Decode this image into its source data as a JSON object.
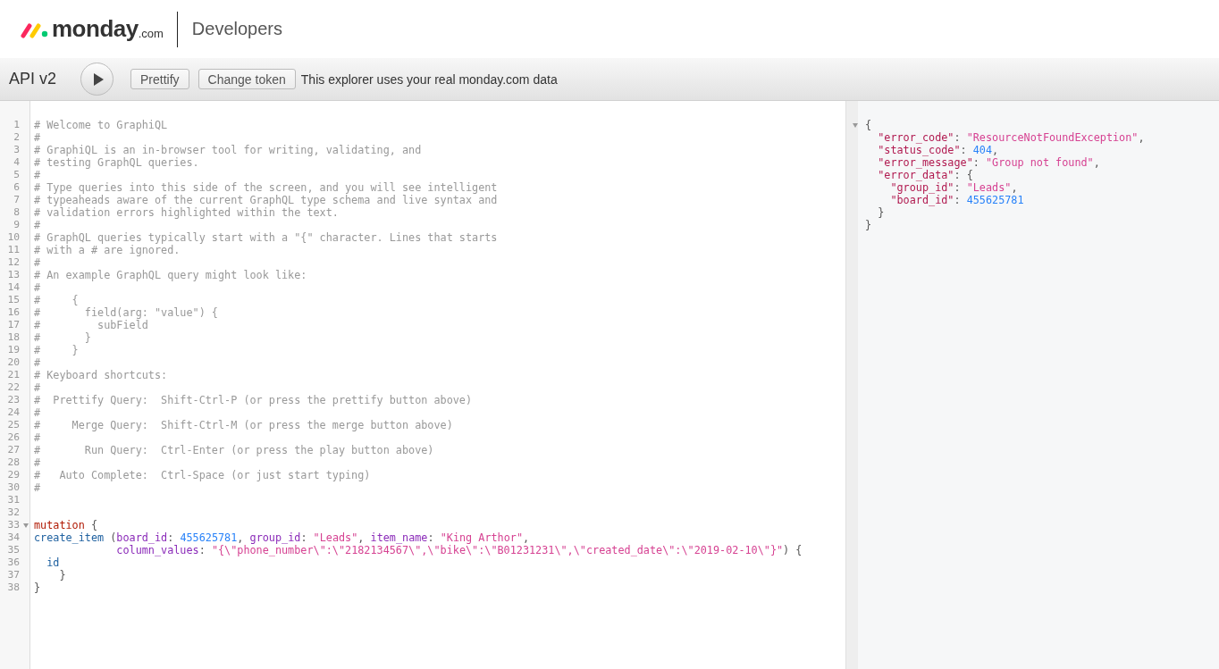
{
  "header": {
    "brand": "monday",
    "brand_suffix": ".com",
    "section": "Developers"
  },
  "toolbar": {
    "title": "API v2",
    "buttons": [
      "Prettify",
      "Change token"
    ],
    "notice": "This explorer uses your real monday.com data"
  },
  "editor": {
    "lines": [
      {
        "number": "1",
        "tokens": [
          {
            "text": "# Welcome to GraphiQL",
            "kind": "comment"
          }
        ]
      },
      {
        "number": "2",
        "tokens": [
          {
            "text": "#",
            "kind": "comment"
          }
        ]
      },
      {
        "number": "3",
        "tokens": [
          {
            "text": "# GraphiQL is an in-browser tool for writing, validating, and",
            "kind": "comment"
          }
        ]
      },
      {
        "number": "4",
        "tokens": [
          {
            "text": "# testing GraphQL queries.",
            "kind": "comment"
          }
        ]
      },
      {
        "number": "5",
        "tokens": [
          {
            "text": "#",
            "kind": "comment"
          }
        ]
      },
      {
        "number": "6",
        "tokens": [
          {
            "text": "# Type queries into this side of the screen, and you will see intelligent",
            "kind": "comment"
          }
        ]
      },
      {
        "number": "7",
        "tokens": [
          {
            "text": "# typeaheads aware of the current GraphQL type schema and live syntax and",
            "kind": "comment"
          }
        ]
      },
      {
        "number": "8",
        "tokens": [
          {
            "text": "# validation errors highlighted within the text.",
            "kind": "comment"
          }
        ]
      },
      {
        "number": "9",
        "tokens": [
          {
            "text": "#",
            "kind": "comment"
          }
        ]
      },
      {
        "number": "10",
        "tokens": [
          {
            "text": "# GraphQL queries typically start with a \"{\" character. Lines that starts",
            "kind": "comment"
          }
        ]
      },
      {
        "number": "11",
        "tokens": [
          {
            "text": "# with a # are ignored.",
            "kind": "comment"
          }
        ]
      },
      {
        "number": "12",
        "tokens": [
          {
            "text": "#",
            "kind": "comment"
          }
        ]
      },
      {
        "number": "13",
        "tokens": [
          {
            "text": "# An example GraphQL query might look like:",
            "kind": "comment"
          }
        ]
      },
      {
        "number": "14",
        "tokens": [
          {
            "text": "#",
            "kind": "comment"
          }
        ]
      },
      {
        "number": "15",
        "tokens": [
          {
            "text": "#     {",
            "kind": "comment"
          }
        ]
      },
      {
        "number": "16",
        "tokens": [
          {
            "text": "#       field(arg: \"value\") {",
            "kind": "comment"
          }
        ]
      },
      {
        "number": "17",
        "tokens": [
          {
            "text": "#         subField",
            "kind": "comment"
          }
        ]
      },
      {
        "number": "18",
        "tokens": [
          {
            "text": "#       }",
            "kind": "comment"
          }
        ]
      },
      {
        "number": "19",
        "tokens": [
          {
            "text": "#     }",
            "kind": "comment"
          }
        ]
      },
      {
        "number": "20",
        "tokens": [
          {
            "text": "#",
            "kind": "comment"
          }
        ]
      },
      {
        "number": "21",
        "tokens": [
          {
            "text": "# Keyboard shortcuts:",
            "kind": "comment"
          }
        ]
      },
      {
        "number": "22",
        "tokens": [
          {
            "text": "#",
            "kind": "comment"
          }
        ]
      },
      {
        "number": "23",
        "tokens": [
          {
            "text": "#  Prettify Query:  Shift-Ctrl-P (or press the prettify button above)",
            "kind": "comment"
          }
        ]
      },
      {
        "number": "24",
        "tokens": [
          {
            "text": "#",
            "kind": "comment"
          }
        ]
      },
      {
        "number": "25",
        "tokens": [
          {
            "text": "#     Merge Query:  Shift-Ctrl-M (or press the merge button above)",
            "kind": "comment"
          }
        ]
      },
      {
        "number": "26",
        "tokens": [
          {
            "text": "#",
            "kind": "comment"
          }
        ]
      },
      {
        "number": "27",
        "tokens": [
          {
            "text": "#       Run Query:  Ctrl-Enter (or press the play button above)",
            "kind": "comment"
          }
        ]
      },
      {
        "number": "28",
        "tokens": [
          {
            "text": "#",
            "kind": "comment"
          }
        ]
      },
      {
        "number": "29",
        "tokens": [
          {
            "text": "#   Auto Complete:  Ctrl-Space (or just start typing)",
            "kind": "comment"
          }
        ]
      },
      {
        "number": "30",
        "tokens": [
          {
            "text": "#",
            "kind": "comment"
          }
        ]
      },
      {
        "number": "31"
      },
      {
        "number": "32"
      },
      {
        "number": "33",
        "foldable": true,
        "tokens": [
          {
            "text": "mutation",
            "kind": "keyword"
          },
          {
            "text": " {",
            "kind": "punct"
          }
        ]
      },
      {
        "number": "34",
        "tokens": [
          {
            "text": "create_item",
            "kind": "def"
          },
          {
            "text": " (",
            "kind": "punct"
          },
          {
            "text": "board_id",
            "kind": "attr"
          },
          {
            "text": ": ",
            "kind": "punct"
          },
          {
            "text": "455625781",
            "kind": "number"
          },
          {
            "text": ", ",
            "kind": "punct"
          },
          {
            "text": "group_id",
            "kind": "attr"
          },
          {
            "text": ": ",
            "kind": "punct"
          },
          {
            "text": "\"Leads\"",
            "kind": "string"
          },
          {
            "text": ", ",
            "kind": "punct"
          },
          {
            "text": "item_name",
            "kind": "attr"
          },
          {
            "text": ": ",
            "kind": "punct"
          },
          {
            "text": "\"King Arthor\"",
            "kind": "string"
          },
          {
            "text": ",",
            "kind": "punct"
          }
        ]
      },
      {
        "number": "35",
        "tokens": [
          {
            "text": "             column_values",
            "kind": "attr"
          },
          {
            "text": ": ",
            "kind": "punct"
          },
          {
            "text": "\"{\\\"phone_number\\\":\\\"2182134567\\\",\\\"bike\\\":\\\"B01231231\\\",\\\"created_date\\\":\\\"2019-02-10\\\"}\"",
            "kind": "string"
          },
          {
            "text": ") {",
            "kind": "punct"
          }
        ]
      },
      {
        "number": "36",
        "tokens": [
          {
            "text": "  id",
            "kind": "def"
          }
        ]
      },
      {
        "number": "37",
        "tokens": [
          {
            "text": "    }",
            "kind": "punct"
          }
        ]
      },
      {
        "number": "38",
        "tokens": [
          {
            "text": "}",
            "kind": "punct"
          }
        ]
      }
    ]
  },
  "response": {
    "lines": [
      {
        "foldable": true,
        "tokens": [
          {
            "text": "{",
            "kind": "punct"
          }
        ]
      },
      {
        "tokens": [
          {
            "text": "  \"error_code\"",
            "kind": "key"
          },
          {
            "text": ": ",
            "kind": "punct"
          },
          {
            "text": "\"ResourceNotFoundException\"",
            "kind": "string"
          },
          {
            "text": ",",
            "kind": "punct"
          }
        ]
      },
      {
        "tokens": [
          {
            "text": "  \"status_code\"",
            "kind": "key"
          },
          {
            "text": ": ",
            "kind": "punct"
          },
          {
            "text": "404",
            "kind": "number"
          },
          {
            "text": ",",
            "kind": "punct"
          }
        ]
      },
      {
        "tokens": [
          {
            "text": "  \"error_message\"",
            "kind": "key"
          },
          {
            "text": ": ",
            "kind": "punct"
          },
          {
            "text": "\"Group not found\"",
            "kind": "string"
          },
          {
            "text": ",",
            "kind": "punct"
          }
        ]
      },
      {
        "tokens": [
          {
            "text": "  \"error_data\"",
            "kind": "key"
          },
          {
            "text": ": {",
            "kind": "punct"
          }
        ]
      },
      {
        "tokens": [
          {
            "text": "    \"group_id\"",
            "kind": "key"
          },
          {
            "text": ": ",
            "kind": "punct"
          },
          {
            "text": "\"Leads\"",
            "kind": "string"
          },
          {
            "text": ",",
            "kind": "punct"
          }
        ]
      },
      {
        "tokens": [
          {
            "text": "    \"board_id\"",
            "kind": "key"
          },
          {
            "text": ": ",
            "kind": "punct"
          },
          {
            "text": "455625781",
            "kind": "number"
          }
        ]
      },
      {
        "tokens": [
          {
            "text": "  }",
            "kind": "punct"
          }
        ]
      },
      {
        "tokens": [
          {
            "text": "}",
            "kind": "punct"
          }
        ]
      }
    ]
  }
}
